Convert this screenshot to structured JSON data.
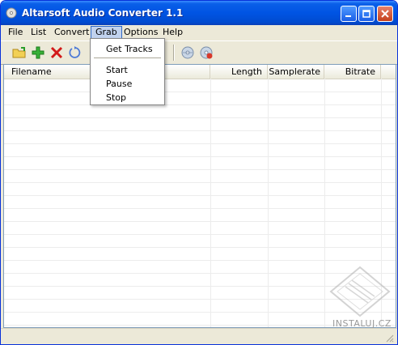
{
  "window": {
    "title": "Altarsoft Audio Converter 1.1"
  },
  "menubar": {
    "items": [
      {
        "label": "File"
      },
      {
        "label": "List"
      },
      {
        "label": "Convert"
      },
      {
        "label": "Grab"
      },
      {
        "label": "Options"
      },
      {
        "label": "Help"
      }
    ]
  },
  "grab_menu": {
    "items": [
      {
        "label": "Get Tracks"
      },
      {
        "label": "Start"
      },
      {
        "label": "Pause"
      },
      {
        "label": "Stop"
      }
    ]
  },
  "toolbar": {
    "icons": [
      "open-folder-icon",
      "add-icon",
      "delete-icon",
      "refresh-icon",
      "cd-icon",
      "cd-grab-icon"
    ]
  },
  "list": {
    "columns": [
      {
        "label": "Filename"
      },
      {
        "label": "Length"
      },
      {
        "label": "Samplerate"
      },
      {
        "label": "Bitrate"
      }
    ],
    "rows": []
  },
  "watermark": {
    "text": "INSTALUJ.CZ"
  },
  "colors": {
    "titlebar": "#0054e3",
    "menu_highlight": "#316ac5",
    "window_bg": "#ece9d8"
  }
}
